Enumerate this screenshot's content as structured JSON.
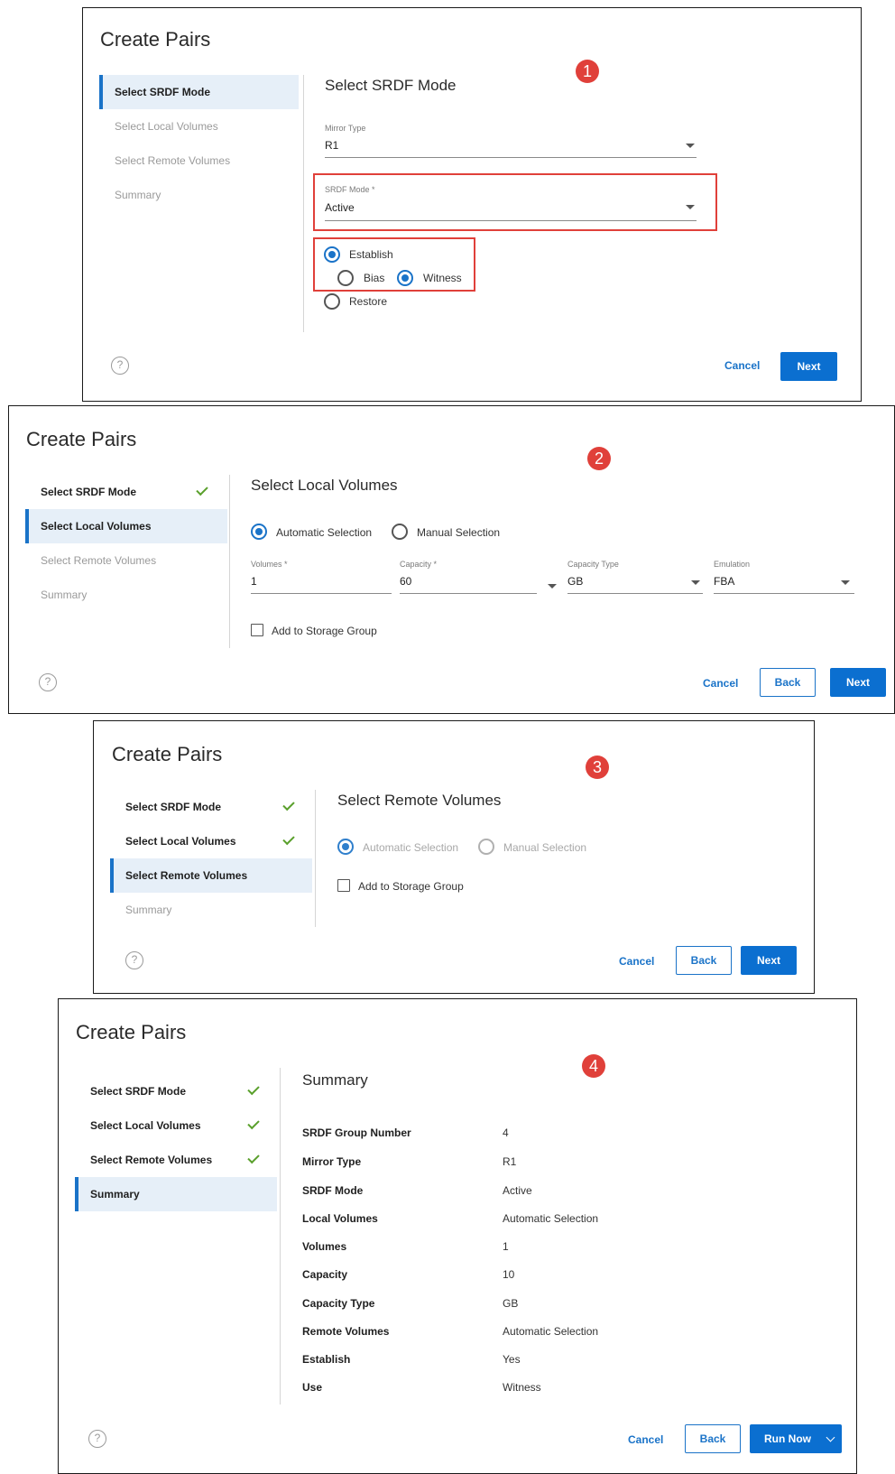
{
  "colors": {
    "accent": "#0b6fd0",
    "check": "#5aa02c",
    "highlight": "#e0403a",
    "nav_active_bg": "#e6eff8"
  },
  "steps": [
    "Select SRDF Mode",
    "Select Local Volumes",
    "Select Remote Volumes",
    "Summary"
  ],
  "buttons": {
    "cancel": "Cancel",
    "back": "Back",
    "next": "Next",
    "run_now": "Run Now"
  },
  "icons": {
    "help": "help-icon",
    "check": "check-icon",
    "dropdown": "chevron-down-icon"
  },
  "panel1": {
    "title": "Create Pairs",
    "badge": "1",
    "section": "Select SRDF Mode",
    "mirror_type": {
      "label": "Mirror Type",
      "value": "R1"
    },
    "srdf_mode": {
      "label": "SRDF Mode *",
      "value": "Active"
    },
    "establish": "Establish",
    "bias": "Bias",
    "witness": "Witness",
    "restore": "Restore"
  },
  "panel2": {
    "title": "Create Pairs",
    "badge": "2",
    "section": "Select Local Volumes",
    "auto": "Automatic Selection",
    "manual": "Manual Selection",
    "volumes": {
      "label": "Volumes *",
      "value": "1"
    },
    "capacity": {
      "label": "Capacity *",
      "value": "60"
    },
    "capacity_type": {
      "label": "Capacity Type",
      "value": "GB"
    },
    "emulation": {
      "label": "Emulation",
      "value": "FBA"
    },
    "add_sg": "Add to Storage Group"
  },
  "panel3": {
    "title": "Create Pairs",
    "badge": "3",
    "section": "Select Remote Volumes",
    "auto": "Automatic Selection",
    "manual": "Manual Selection",
    "add_sg": "Add to Storage Group"
  },
  "panel4": {
    "title": "Create Pairs",
    "badge": "4",
    "section": "Summary",
    "rows": [
      {
        "key": "SRDF Group Number",
        "value": "4"
      },
      {
        "key": "Mirror Type",
        "value": "R1"
      },
      {
        "key": "SRDF Mode",
        "value": "Active"
      },
      {
        "key": "Local Volumes",
        "value": "Automatic Selection"
      },
      {
        "key": "Volumes",
        "value": "1"
      },
      {
        "key": "Capacity",
        "value": "10"
      },
      {
        "key": "Capacity Type",
        "value": "GB"
      },
      {
        "key": "Remote Volumes",
        "value": "Automatic Selection"
      },
      {
        "key": "Establish",
        "value": "Yes"
      },
      {
        "key": "Use",
        "value": "Witness"
      }
    ]
  }
}
